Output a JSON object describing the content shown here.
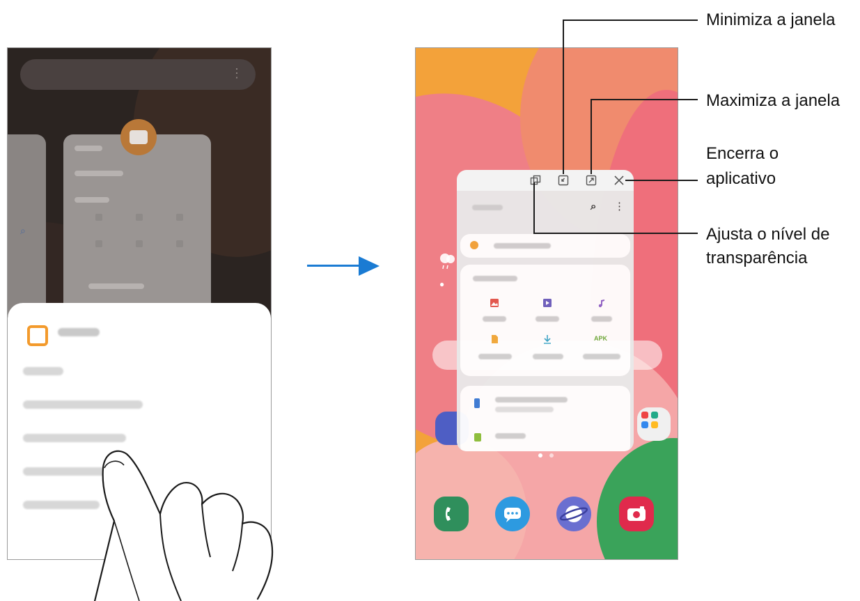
{
  "callouts": {
    "minimize": "Minimiza a janela",
    "maximize": "Maximiza a janela",
    "close_line1": "Encerra o",
    "close_line2": "aplicativo",
    "transparency_line1": "Ajusta o nível de",
    "transparency_line2": "transparência"
  },
  "popup_toolbar": {
    "icons": [
      "transparency-icon",
      "minimize-icon",
      "maximize-icon",
      "close-icon"
    ]
  },
  "popup_storage": {
    "tile_icons": [
      "image-icon",
      "video-icon",
      "audio-icon",
      "document-icon",
      "download-icon",
      "apk-icon"
    ],
    "apk_label": "APK"
  },
  "dock": {
    "icons": [
      "phone-icon",
      "messages-icon",
      "internet-icon",
      "camera-icon"
    ]
  },
  "colors": {
    "accent_arrow": "#1a7bd3",
    "wallpaper_orange": "#f3a23a",
    "wallpaper_pink": "#ef7f86",
    "dock_phone": "#2f8f5c",
    "dock_messages": "#2d9ae0",
    "dock_internet": "#6a6fd0",
    "dock_camera": "#e02a4c"
  }
}
